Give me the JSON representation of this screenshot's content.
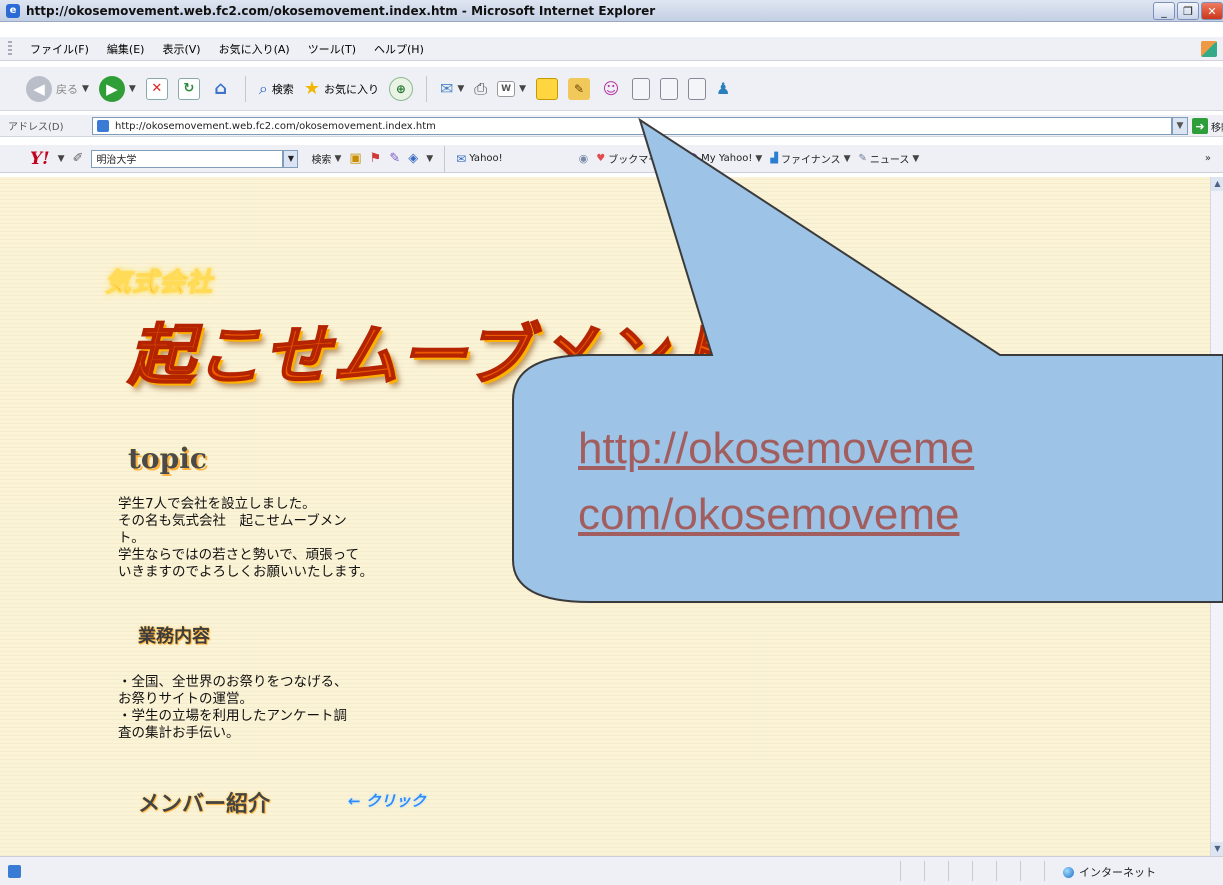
{
  "window": {
    "title": "http://okosemovement.web.fc2.com/okosemovement.index.htm - Microsoft Internet Explorer",
    "minimize": "_",
    "restore": "❐",
    "close": "✕"
  },
  "menu": {
    "items": [
      "ファイル(F)",
      "編集(E)",
      "表示(V)",
      "お気に入り(A)",
      "ツール(T)",
      "ヘルプ(H)"
    ]
  },
  "toolbar": {
    "back_label": "戻る",
    "search_label": "検索",
    "favorites_label": "お気に入り"
  },
  "address": {
    "label": "アドレス(D)",
    "url": "http://okosemovement.web.fc2.com/okosemovement.index.htm",
    "go_label": "移動"
  },
  "yahoo_toolbar": {
    "logo": "Y!",
    "search_value": "明治大学",
    "search_button": "検索",
    "mail_label": "Yahoo!",
    "bookmark_label": "ブックマーク",
    "my_yahoo_label": "My Yahoo!",
    "finance_label": "ファイナンス",
    "news_label": "ニュース"
  },
  "page": {
    "kishiki": "気式会社",
    "company_name": "起こせムーブメント",
    "topic_heading": "topic",
    "topic_text": "学生7人で会社を設立しました。\nその名も気式会社　起こせムーブメン\nト。\n学生ならではの若さと勢いで、頑張って\nいきますのでよろしくお願いいたします。",
    "business_heading": "業務内容",
    "business_text": "・全国、全世界のお祭りをつなげる、\nお祭りサイトの運営。\n・学生の立場を利用したアンケート調\n査の集計お手伝い。",
    "member_heading": "メンバー紹介",
    "member_link": "← クリック"
  },
  "status": {
    "zone": "インターネット"
  },
  "callout": {
    "line1": "http://okosemoveme",
    "line2": "com/okosemoveme",
    "fill_color": "#9dc3e6"
  }
}
